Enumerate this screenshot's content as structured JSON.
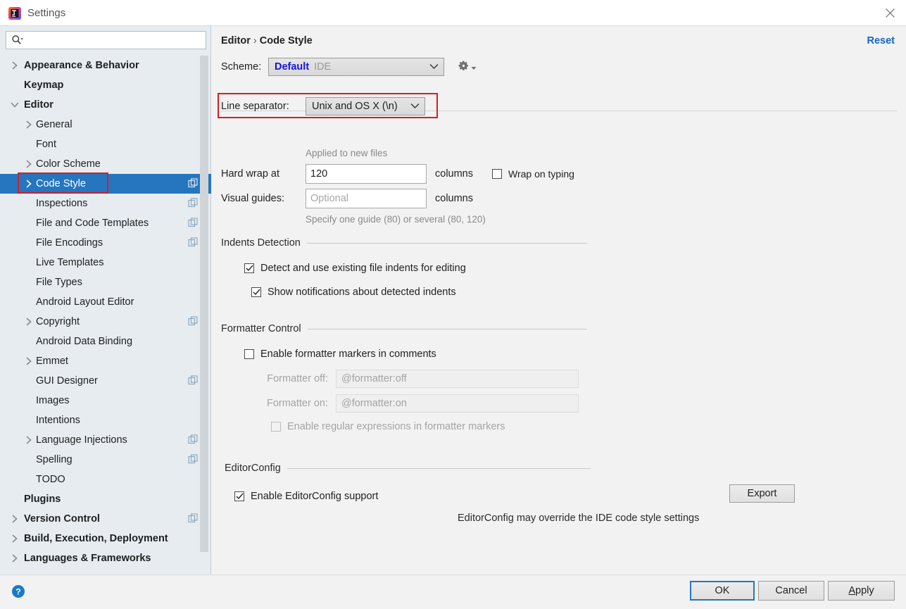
{
  "window": {
    "title": "Settings",
    "icon": "intellij-idea-logo",
    "close_icon": "close-icon"
  },
  "sidebar": {
    "search": {
      "placeholder": "",
      "value": "",
      "icon": "search-icon"
    },
    "items": [
      {
        "label": "Appearance & Behavior",
        "bold": true,
        "indent": 0,
        "arrow": "collapsed",
        "badge": false
      },
      {
        "label": "Keymap",
        "bold": true,
        "indent": 0,
        "arrow": "none",
        "badge": false
      },
      {
        "label": "Editor",
        "bold": true,
        "indent": 0,
        "arrow": "expanded",
        "badge": false
      },
      {
        "label": "General",
        "bold": false,
        "indent": 1,
        "arrow": "collapsed",
        "badge": false
      },
      {
        "label": "Font",
        "bold": false,
        "indent": 1,
        "arrow": "none",
        "badge": false
      },
      {
        "label": "Color Scheme",
        "bold": false,
        "indent": 1,
        "arrow": "collapsed",
        "badge": false
      },
      {
        "label": "Code Style",
        "bold": false,
        "indent": 1,
        "arrow": "collapsed",
        "badge": true,
        "selected": true,
        "highlighted": true
      },
      {
        "label": "Inspections",
        "bold": false,
        "indent": 1,
        "arrow": "none",
        "badge": true
      },
      {
        "label": "File and Code Templates",
        "bold": false,
        "indent": 1,
        "arrow": "none",
        "badge": true
      },
      {
        "label": "File Encodings",
        "bold": false,
        "indent": 1,
        "arrow": "none",
        "badge": true
      },
      {
        "label": "Live Templates",
        "bold": false,
        "indent": 1,
        "arrow": "none",
        "badge": false
      },
      {
        "label": "File Types",
        "bold": false,
        "indent": 1,
        "arrow": "none",
        "badge": false
      },
      {
        "label": "Android Layout Editor",
        "bold": false,
        "indent": 1,
        "arrow": "none",
        "badge": false
      },
      {
        "label": "Copyright",
        "bold": false,
        "indent": 1,
        "arrow": "collapsed",
        "badge": true
      },
      {
        "label": "Android Data Binding",
        "bold": false,
        "indent": 1,
        "arrow": "none",
        "badge": false
      },
      {
        "label": "Emmet",
        "bold": false,
        "indent": 1,
        "arrow": "collapsed",
        "badge": false
      },
      {
        "label": "GUI Designer",
        "bold": false,
        "indent": 1,
        "arrow": "none",
        "badge": true
      },
      {
        "label": "Images",
        "bold": false,
        "indent": 1,
        "arrow": "none",
        "badge": false
      },
      {
        "label": "Intentions",
        "bold": false,
        "indent": 1,
        "arrow": "none",
        "badge": false
      },
      {
        "label": "Language Injections",
        "bold": false,
        "indent": 1,
        "arrow": "collapsed",
        "badge": true
      },
      {
        "label": "Spelling",
        "bold": false,
        "indent": 1,
        "arrow": "none",
        "badge": true
      },
      {
        "label": "TODO",
        "bold": false,
        "indent": 1,
        "arrow": "none",
        "badge": false
      },
      {
        "label": "Plugins",
        "bold": true,
        "indent": 0,
        "arrow": "none",
        "badge": false
      },
      {
        "label": "Version Control",
        "bold": true,
        "indent": 0,
        "arrow": "collapsed",
        "badge": true
      },
      {
        "label": "Build, Execution, Deployment",
        "bold": true,
        "indent": 0,
        "arrow": "collapsed",
        "badge": false
      },
      {
        "label": "Languages & Frameworks",
        "bold": true,
        "indent": 0,
        "arrow": "collapsed",
        "badge": false
      }
    ]
  },
  "content": {
    "breadcrumb": {
      "parent": "Editor",
      "separator": "›",
      "current": "Code Style"
    },
    "reset_label": "Reset",
    "scheme": {
      "label": "Scheme:",
      "value_primary": "Default",
      "value_secondary": "IDE",
      "gear_icon": "gear-icon"
    },
    "line_separator": {
      "label": "Line separator:",
      "value": "Unix and OS X (\\n)",
      "note": "Applied to new files",
      "highlight_color": "#cf2026"
    },
    "hard_wrap": {
      "label": "Hard wrap at",
      "value": "120",
      "unit": "columns",
      "wrap_on_typing_label": "Wrap on typing",
      "wrap_on_typing_checked": false
    },
    "visual_guides": {
      "label": "Visual guides:",
      "placeholder": "Optional",
      "value": "",
      "unit": "columns",
      "hint": "Specify one guide (80) or several (80, 120)"
    },
    "indents_detection": {
      "title": "Indents Detection",
      "detect_label": "Detect and use existing file indents for editing",
      "detect_checked": true,
      "notify_label": "Show notifications about detected indents",
      "notify_checked": true
    },
    "formatter_control": {
      "title": "Formatter Control",
      "enable_label": "Enable formatter markers in comments",
      "enable_checked": false,
      "off_label": "Formatter off:",
      "off_value": "@formatter:off",
      "on_label": "Formatter on:",
      "on_value": "@formatter:on",
      "regex_label": "Enable regular expressions in formatter markers",
      "regex_checked": false
    },
    "editorconfig": {
      "title": "EditorConfig",
      "enable_label": "Enable EditorConfig support",
      "enable_checked": true,
      "export_label": "Export",
      "note": "EditorConfig may override the IDE code style settings"
    }
  },
  "footer": {
    "help_icon": "help-icon",
    "ok_label": "OK",
    "cancel_label": "Cancel",
    "apply_label_a": "A",
    "apply_label_rest": "pply"
  },
  "colors": {
    "selection": "#2675bf",
    "accent_link": "#1565c0",
    "highlight": "#cf2026",
    "sidebar_bg": "#e6ecf0",
    "content_bg": "#f2f2f2"
  }
}
